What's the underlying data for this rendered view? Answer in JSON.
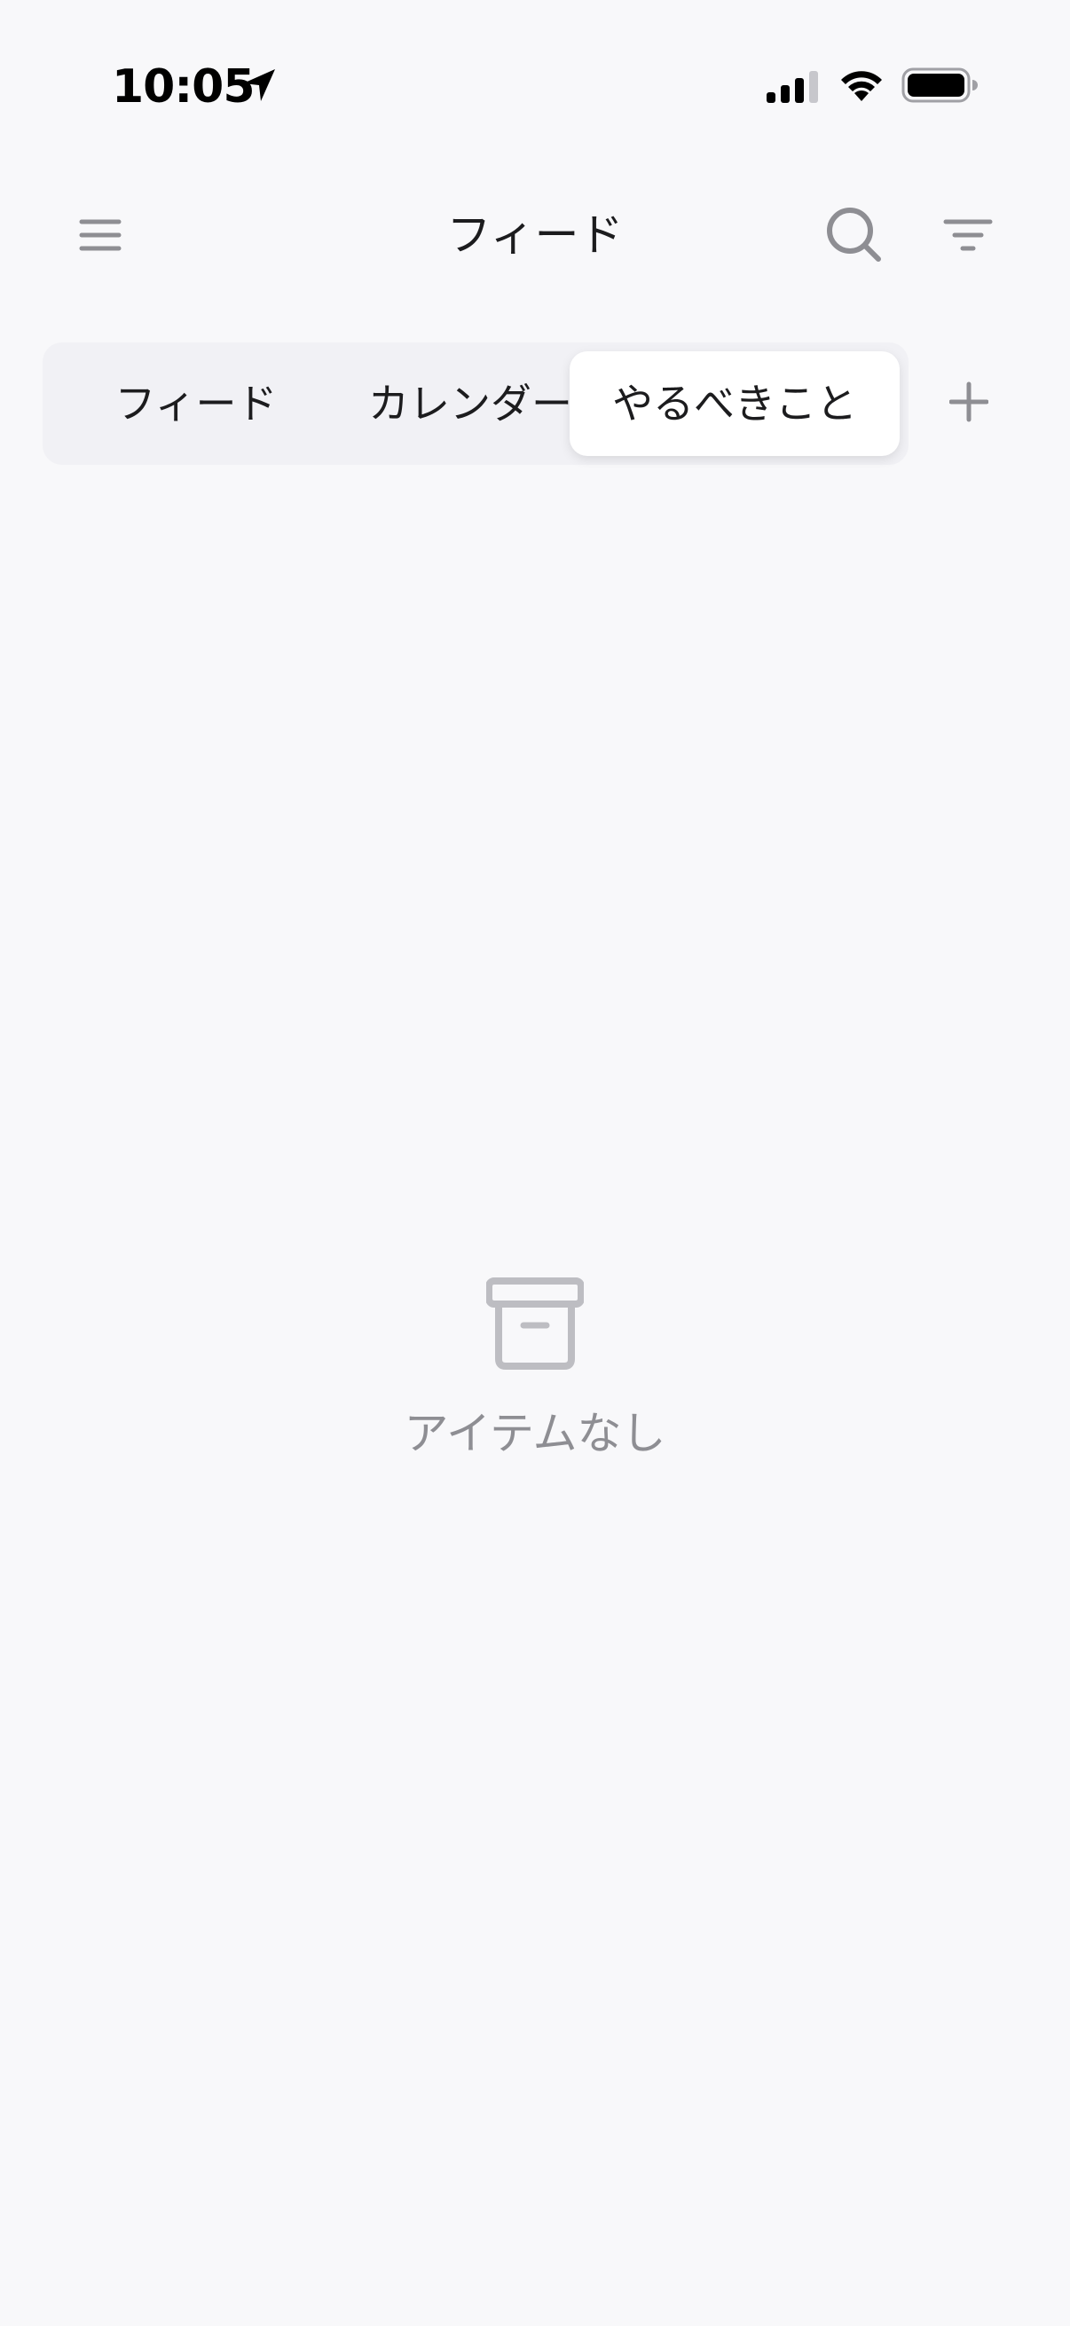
{
  "status_bar": {
    "time": "10:05",
    "icons": [
      "location-arrow-icon",
      "cellular-signal-icon",
      "wifi-icon",
      "battery-icon"
    ]
  },
  "nav": {
    "title": "フィード",
    "left_icon": "menu-icon",
    "right_icons": [
      "search-icon",
      "filter-icon"
    ]
  },
  "tabs": {
    "items": [
      {
        "label": "フィード",
        "selected": false
      },
      {
        "label": "カレンダー",
        "selected": false
      },
      {
        "label": "やるべきこと",
        "selected": true
      }
    ],
    "add_icon": "plus-icon"
  },
  "empty_state": {
    "icon": "archive-box-icon",
    "message": "アイテムなし"
  },
  "colors": {
    "background": "#F8F8FA",
    "segment_bg": "#F1F1F5",
    "selected_segment": "#FFFFFF",
    "icon_gray": "#8E8E93",
    "empty_icon": "#BDBDC2",
    "text": "#1C1C1E"
  }
}
